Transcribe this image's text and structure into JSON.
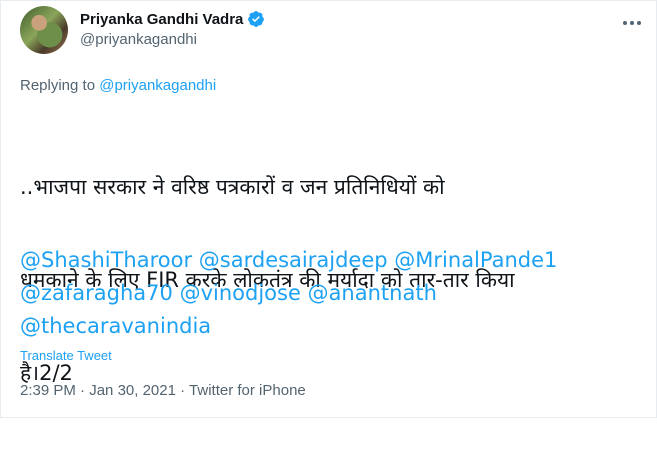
{
  "author": {
    "name": "Priyanka Gandhi Vadra",
    "handle": "@priyankagandhi",
    "verified_icon": "verified-badge-icon"
  },
  "reply": {
    "prefix": "Replying to ",
    "target": "@priyankagandhi"
  },
  "tweet": {
    "line1": "..भाजपा सरकार ने वरिष्ठ पत्रकारों व जन प्रतिनिधियों को",
    "line2": "धमकाने के लिए FIR करके लोकतंत्र की मर्यादा को तार-तार किया",
    "line3": "है।2/2",
    "mentions": [
      "@ShashiTharoor",
      "@sardesairajdeep",
      "@MrinalPande1",
      "@zafaragha70",
      "@vinodjose",
      "@anantnath",
      "@thecaravanindia"
    ]
  },
  "translate_label": "Translate Tweet",
  "meta": {
    "time": "2:39 PM",
    "separator": " · ",
    "date": "Jan 30, 2021",
    "source": "Twitter for iPhone"
  },
  "colors": {
    "accent": "#1da1f2",
    "muted": "#536471",
    "text": "#0f1419"
  }
}
